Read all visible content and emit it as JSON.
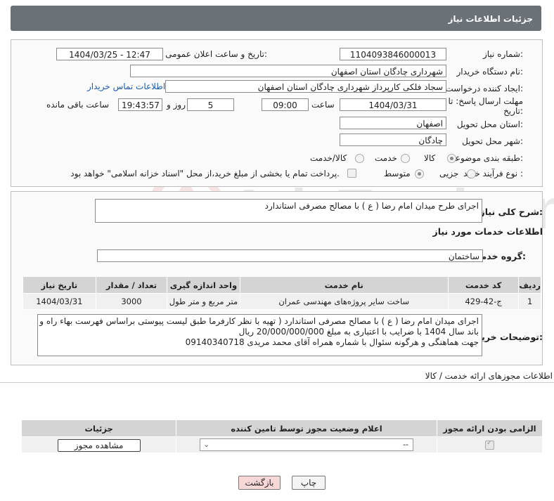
{
  "header": {
    "title": "جزئیات اطلاعات نیاز"
  },
  "form": {
    "need_number_label": "شماره نیاز:",
    "need_number": "1104093846000013",
    "announce_label": "تاریخ و ساعت اعلان عمومی:",
    "announce_value": "1404/03/25 - 12:47",
    "buyer_org_label": "نام دستگاه خریدار:",
    "buyer_org": "شهرداری چادگان استان اصفهان",
    "creator_label": "ایجاد کننده درخواست:",
    "creator": "سجاد فلکی کارپرداز شهرداری چادگان استان اصفهان",
    "contact_link": "اطلاعات تماس خریدار",
    "deadline_label_1": "مهلت ارسال پاسخ: تا",
    "deadline_label_2": "تاریخ:",
    "deadline_date": "1404/03/31",
    "time_label": "ساعت",
    "deadline_time": "09:00",
    "days_value": "5",
    "days_label": "روز و",
    "remaining_time": "19:43:57",
    "remaining_label": "ساعت باقی مانده",
    "province_label": "استان محل تحویل:",
    "province": "اصفهان",
    "city_label": "شهر محل تحویل:",
    "city": "چادگان",
    "category_label": "طبقه بندی موضوعی:",
    "category_options": [
      "کالا",
      "خدمت",
      "کالا/خدمت"
    ],
    "process_label": "نوع فرآیند خرید :",
    "process_options": [
      "جزیی",
      "متوسط"
    ],
    "payment_note": "پرداخت تمام یا بخشی از مبلغ خرید،از محل \"اسناد خزانه اسلامی\" خواهد بود."
  },
  "summary": {
    "label": "شرح کلی نیاز:",
    "text": "اجرای طرح میدان امام رضا ( ع ) با مصالح مصرفی استاندارد"
  },
  "services": {
    "title": "اطلاعات خدمات مورد نیاز",
    "group_label": "گروه خدمت:",
    "group_value": "ساختمان",
    "columns": [
      "ردیف",
      "کد خدمت",
      "نام خدمت",
      "واحد اندازه گیری",
      "تعداد / مقدار",
      "تاریخ نیاز"
    ],
    "rows": [
      [
        "1",
        "ج-42-429",
        "ساخت سایر پروژه‌های مهندسی عمران",
        "متر مربع و متر طول",
        "3000",
        "1404/03/31"
      ]
    ]
  },
  "buyer_notes": {
    "label": "توضیحات خریدار:",
    "line1": "اجرای میدان امام رضا ( ع ) با مصالح مصرفی استاندارد ( تهیه با نظر کارفرما طبق لیست پیوستی براساس فهرست بهاء راه و",
    "line2": "باند سال 1404 با ضرایب با اعتباری به مبلغ 20/000/000/000 ریال",
    "line3": "جهت هماهنگی و هرگونه سئوال با شماره همراه آقای محمد مریدی 09140340718"
  },
  "permits": {
    "title": "اطلاعات مجوزهای ارائه خدمت / کالا",
    "columns": [
      "الزامی بودن ارائه مجوز",
      "اعلام وضعیت مجوز توسط تامین کننده",
      "جزئیات"
    ],
    "select_value": "--",
    "view_button": "مشاهده مجوز"
  },
  "footer": {
    "print_button": "چاپ",
    "back_button": "بازگشت"
  },
  "watermark": {
    "text": "AriaTender.neT"
  },
  "colors": {
    "header_bg": "#6a7278",
    "link": "#1a5cb0",
    "back_btn_bg": "#f8d7d7"
  }
}
